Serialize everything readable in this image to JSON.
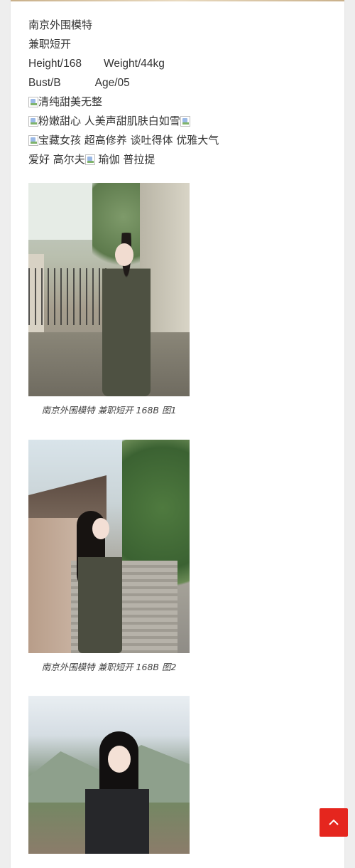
{
  "profile": {
    "line1": "南京外围模特",
    "line2": "兼职短开",
    "height": "Height/168",
    "weight": "Weight/44kg",
    "bust": "Bust/B",
    "age": "Age/05",
    "tag1": "清纯甜美无整",
    "tag2": "粉嫩甜心 人美声甜肌肤白如雪",
    "tag3": "宝藏女孩 超高修养 谈吐得体 优雅大气",
    "hobby_prefix": "爱好 高尔夫",
    "hobby_suffix": " 瑜伽 普拉提"
  },
  "gallery": [
    {
      "caption": "南京外围模特 兼职短开 168B 图1"
    },
    {
      "caption": "南京外围模特 兼职短开 168B 图2"
    },
    {
      "caption": ""
    }
  ],
  "icons": {
    "broken_image": "broken-image-icon",
    "scroll_top": "chevron-up-icon"
  },
  "colors": {
    "scroll_top_bg": "#e5261e",
    "page_bg": "#eeeeee",
    "card_bg": "#ffffff"
  }
}
